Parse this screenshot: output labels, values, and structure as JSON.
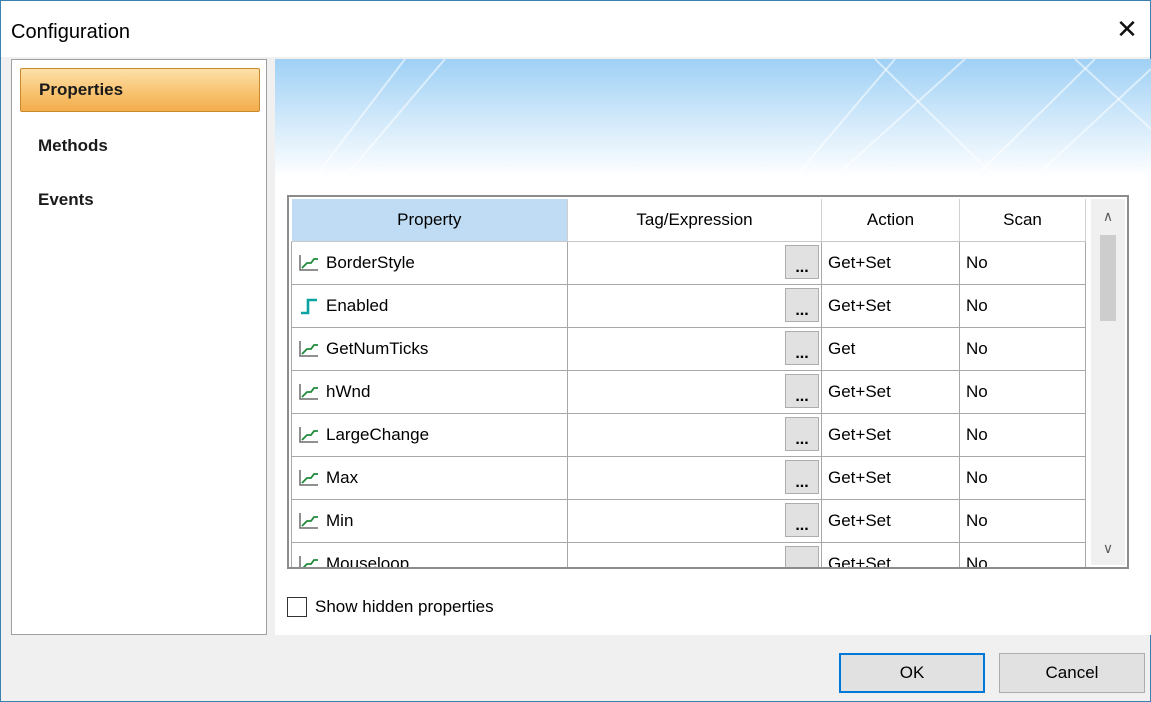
{
  "window": {
    "title": "Configuration",
    "close_glyph": "✕"
  },
  "sidebar": {
    "items": [
      {
        "label": "Properties",
        "selected": true
      },
      {
        "label": "Methods",
        "selected": false
      },
      {
        "label": "Events",
        "selected": false
      }
    ]
  },
  "grid": {
    "columns": [
      "Property",
      "Tag/Expression",
      "Action",
      "Scan"
    ],
    "browse_label": "...",
    "rows": [
      {
        "name": "BorderStyle",
        "icon": "analog-step-icon",
        "tag": "",
        "action": "Get+Set",
        "scan": "No"
      },
      {
        "name": "Enabled",
        "icon": "digital-step-icon",
        "tag": "",
        "action": "Get+Set",
        "scan": "No"
      },
      {
        "name": "GetNumTicks",
        "icon": "analog-step-icon",
        "tag": "",
        "action": "Get",
        "scan": "No"
      },
      {
        "name": "hWnd",
        "icon": "analog-step-icon",
        "tag": "",
        "action": "Get+Set",
        "scan": "No"
      },
      {
        "name": "LargeChange",
        "icon": "analog-step-icon",
        "tag": "",
        "action": "Get+Set",
        "scan": "No"
      },
      {
        "name": "Max",
        "icon": "analog-step-icon",
        "tag": "",
        "action": "Get+Set",
        "scan": "No"
      },
      {
        "name": "Min",
        "icon": "analog-step-icon",
        "tag": "",
        "action": "Get+Set",
        "scan": "No"
      },
      {
        "name": "Mouseloop",
        "icon": "analog-step-icon",
        "tag": "",
        "action": "Get+Set",
        "scan": "No"
      }
    ],
    "scroll_up_glyph": "∧",
    "scroll_down_glyph": "∨"
  },
  "options": {
    "show_hidden_label": "Show hidden properties",
    "show_hidden_checked": false
  },
  "buttons": {
    "ok": "OK",
    "cancel": "Cancel"
  },
  "colors": {
    "selected_nav": "#f8c371",
    "header_selected": "#bfdcf4",
    "default_button_border": "#0078d7"
  }
}
